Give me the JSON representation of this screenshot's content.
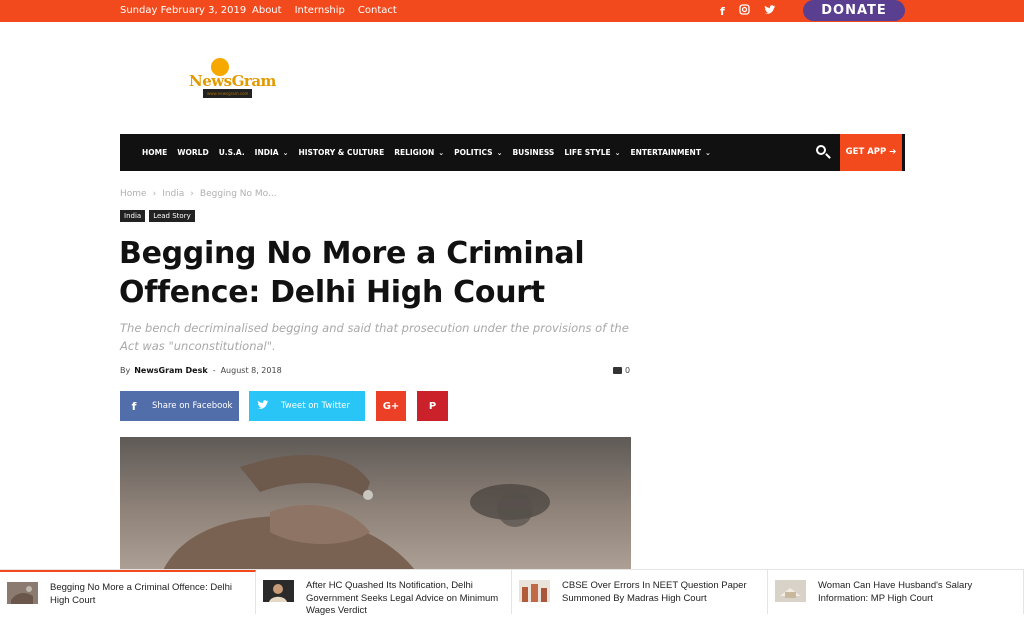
{
  "topbar": {
    "date": "Sunday February 3, 2019",
    "links": [
      "About",
      "Internship",
      "Contact"
    ],
    "social_icons": [
      "facebook-icon",
      "instagram-icon",
      "twitter-icon"
    ],
    "donate_label": "DONATE"
  },
  "logo": {
    "name": "NewsGram",
    "tagline": "www.newsgram.com"
  },
  "nav": {
    "items": [
      {
        "label": "HOME",
        "dropdown": false
      },
      {
        "label": "WORLD",
        "dropdown": false
      },
      {
        "label": "U.S.A.",
        "dropdown": false
      },
      {
        "label": "INDIA",
        "dropdown": true
      },
      {
        "label": "HISTORY & CULTURE",
        "dropdown": false
      },
      {
        "label": "RELIGION",
        "dropdown": true
      },
      {
        "label": "POLITICS",
        "dropdown": true
      },
      {
        "label": "BUSINESS",
        "dropdown": false
      },
      {
        "label": "LIFE STYLE",
        "dropdown": true
      },
      {
        "label": "ENTERTAINMENT",
        "dropdown": true
      }
    ],
    "get_app_label": "GET APP ➔"
  },
  "breadcrumb": [
    "Home",
    "India",
    "Begging No Mo..."
  ],
  "tags": [
    "India",
    "Lead Story"
  ],
  "article": {
    "title": "Begging No More a Criminal Offence: Delhi High Court",
    "subtitle": "The bench decriminalised begging and said that prosecution under the provisions of the Act was \"unconstitutional\".",
    "by_label": "By",
    "author": "NewsGram Desk",
    "date": "August 8, 2018",
    "comment_count": "0"
  },
  "share": {
    "facebook_label": "Share on Facebook",
    "twitter_label": "Tweet on Twitter",
    "googleplus_label": "G+",
    "pinterest_label": "P"
  },
  "related": [
    {
      "title": "Begging No More a Criminal Offence: Delhi High Court"
    },
    {
      "title": "After HC Quashed Its Notification, Delhi Government Seeks Legal Advice on Minimum Wages Verdict"
    },
    {
      "title": "CBSE Over Errors In NEET Question Paper Summoned By Madras High Court"
    },
    {
      "title": "Woman Can Have Husband's Salary Information: MP High Court"
    }
  ],
  "colors": {
    "accent": "#f24a1d",
    "donate": "#5a3e8f",
    "nav_bg": "#111111",
    "facebook": "#516eab",
    "twitter": "#29c5f6",
    "googleplus": "#eb4026",
    "pinterest": "#ca212a"
  }
}
